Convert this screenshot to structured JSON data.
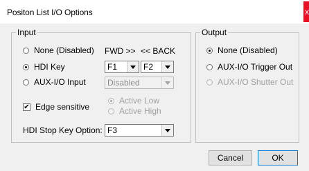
{
  "window": {
    "title": "Positon List I/O Options",
    "close_glyph": "x"
  },
  "input_group": {
    "title": "Input",
    "options": [
      {
        "label": "None (Disabled)",
        "selected": false
      },
      {
        "label": "HDI Key",
        "selected": true
      },
      {
        "label": "AUX-I/O Input",
        "selected": false
      }
    ],
    "fwd_label": "FWD >>",
    "back_label": "<< BACK",
    "fwd_select": {
      "value": "F1"
    },
    "back_select": {
      "value": "F2"
    },
    "aux_select": {
      "value": "Disabled"
    },
    "edge_sensitive": {
      "label": "Edge sensitive",
      "checked": true,
      "mark": "✔"
    },
    "active_low": {
      "label": "Active Low",
      "selected": true
    },
    "active_high": {
      "label": "Active High",
      "selected": false
    },
    "stop_key": {
      "label": "HDI Stop Key Option:",
      "value": "F3"
    }
  },
  "output_group": {
    "title": "Output",
    "options": [
      {
        "label": "None (Disabled)",
        "selected": true
      },
      {
        "label": "AUX-I/O Trigger Out",
        "selected": false
      },
      {
        "label": "AUX-I/O Shutter Out",
        "selected": false
      }
    ]
  },
  "buttons": {
    "cancel": "Cancel",
    "ok": "OK"
  }
}
